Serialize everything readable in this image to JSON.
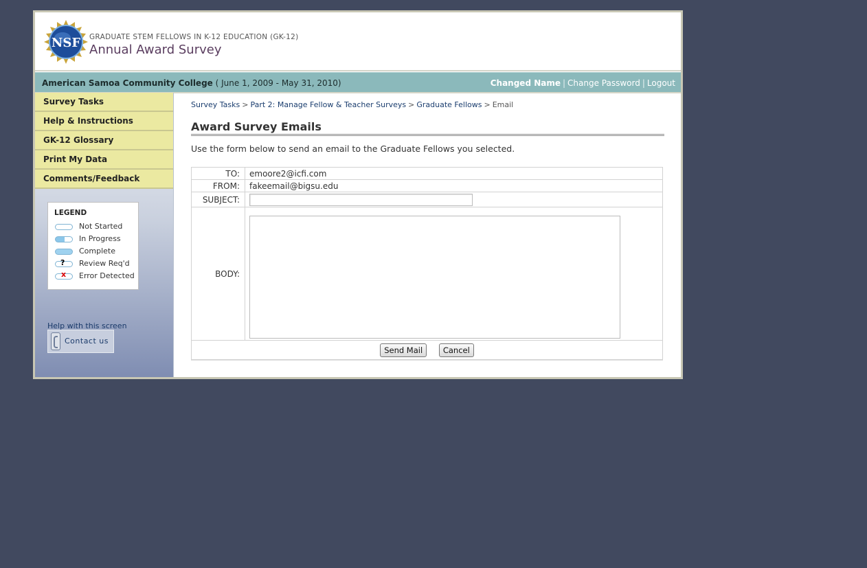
{
  "header": {
    "program": "GRADUATE STEM FELLOWS IN K-12 EDUCATION (GK-12)",
    "title": "Annual Award Survey",
    "logo_text": "NSF"
  },
  "topbar": {
    "institution": "American Samoa Community College",
    "period": "( June 1, 2009 - May 31, 2010)",
    "user": "Changed Name",
    "change_password": "Change Password",
    "logout": "Logout",
    "separator": "|"
  },
  "sidebar": {
    "items": [
      {
        "label": "Survey Tasks"
      },
      {
        "label": "Help & Instructions"
      },
      {
        "label": "GK-12 Glossary"
      },
      {
        "label": "Print My Data"
      },
      {
        "label": "Comments/Feedback"
      }
    ],
    "legend": {
      "title": "LEGEND",
      "items": [
        {
          "label": "Not Started"
        },
        {
          "label": "In Progress"
        },
        {
          "label": "Complete"
        },
        {
          "label": "Review Req'd"
        },
        {
          "label": "Error Detected"
        }
      ]
    },
    "help_label": "Help with this screen",
    "contact_label": "Contact us"
  },
  "breadcrumb": {
    "items": [
      "Survey Tasks",
      "Part 2: Manage Fellow & Teacher Surveys",
      "Graduate Fellows"
    ],
    "current": "Email",
    "separator": ">"
  },
  "main": {
    "title": "Award Survey Emails",
    "intro": "Use the form below to send an email to the Graduate Fellows you selected."
  },
  "form": {
    "to_label": "TO:",
    "to_value": "emoore2@icfi.com",
    "from_label": "FROM:",
    "from_value": "fakeemail@bigsu.edu",
    "subject_label": "SUBJECT:",
    "subject_value": "",
    "body_label": "BODY:",
    "body_value": "",
    "send_label": "Send Mail",
    "cancel_label": "Cancel"
  },
  "colors": {
    "page_bg": "#41495f",
    "topbar": "#8bb9bb",
    "nav_item": "#ebe9a1",
    "link": "#1a3d6e"
  }
}
